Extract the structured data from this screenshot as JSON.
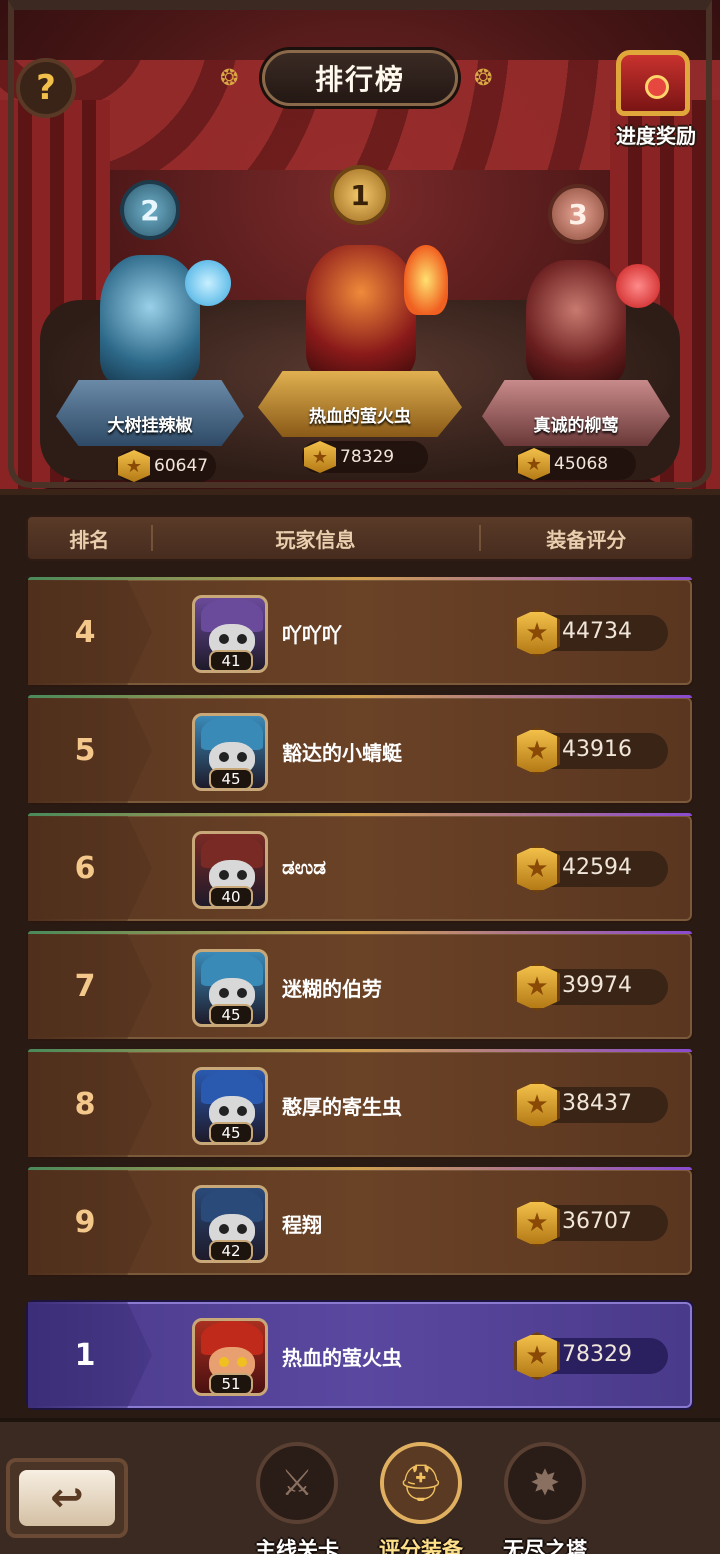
{
  "header": {
    "title": "排行榜",
    "help_icon": "question-mark-icon",
    "reward_label": "进度奖励"
  },
  "podium": [
    {
      "rank": "2",
      "name": "大树挂辣椒",
      "score": "60647"
    },
    {
      "rank": "1",
      "name": "热血的萤火虫",
      "score": "78329"
    },
    {
      "rank": "3",
      "name": "真诚的柳莺",
      "score": "45068"
    }
  ],
  "columns": {
    "rank": "排名",
    "player": "玩家信息",
    "score": "装备评分"
  },
  "rows": [
    {
      "rank": "4",
      "level": "41",
      "name": "吖吖吖",
      "score": "44734",
      "hat": "#6a4a9a"
    },
    {
      "rank": "5",
      "level": "45",
      "name": "豁达的小蜻蜓",
      "score": "43916",
      "hat": "#3a8ab8"
    },
    {
      "rank": "6",
      "level": "40",
      "name": "ಡಉಡ",
      "score": "42594",
      "hat": "#7a2a24"
    },
    {
      "rank": "7",
      "level": "45",
      "name": "迷糊的伯劳",
      "score": "39974",
      "hat": "#3a8ab8"
    },
    {
      "rank": "8",
      "level": "45",
      "name": "憨厚的寄生虫",
      "score": "38437",
      "hat": "#2a5ab0"
    },
    {
      "rank": "9",
      "level": "42",
      "name": "程翔",
      "score": "36707",
      "hat": "#2a4a7a"
    }
  ],
  "self": {
    "rank": "1",
    "level": "51",
    "name": "热血的萤火虫",
    "score": "78329"
  },
  "nav": {
    "back_icon": "back-arrow-icon",
    "tabs": [
      {
        "label": "主线关卡",
        "icon": "crossed-swords-icon"
      },
      {
        "label": "评分装备",
        "icon": "helmet-icon"
      },
      {
        "label": "无尽之塔",
        "icon": "tower-icon"
      }
    ]
  }
}
